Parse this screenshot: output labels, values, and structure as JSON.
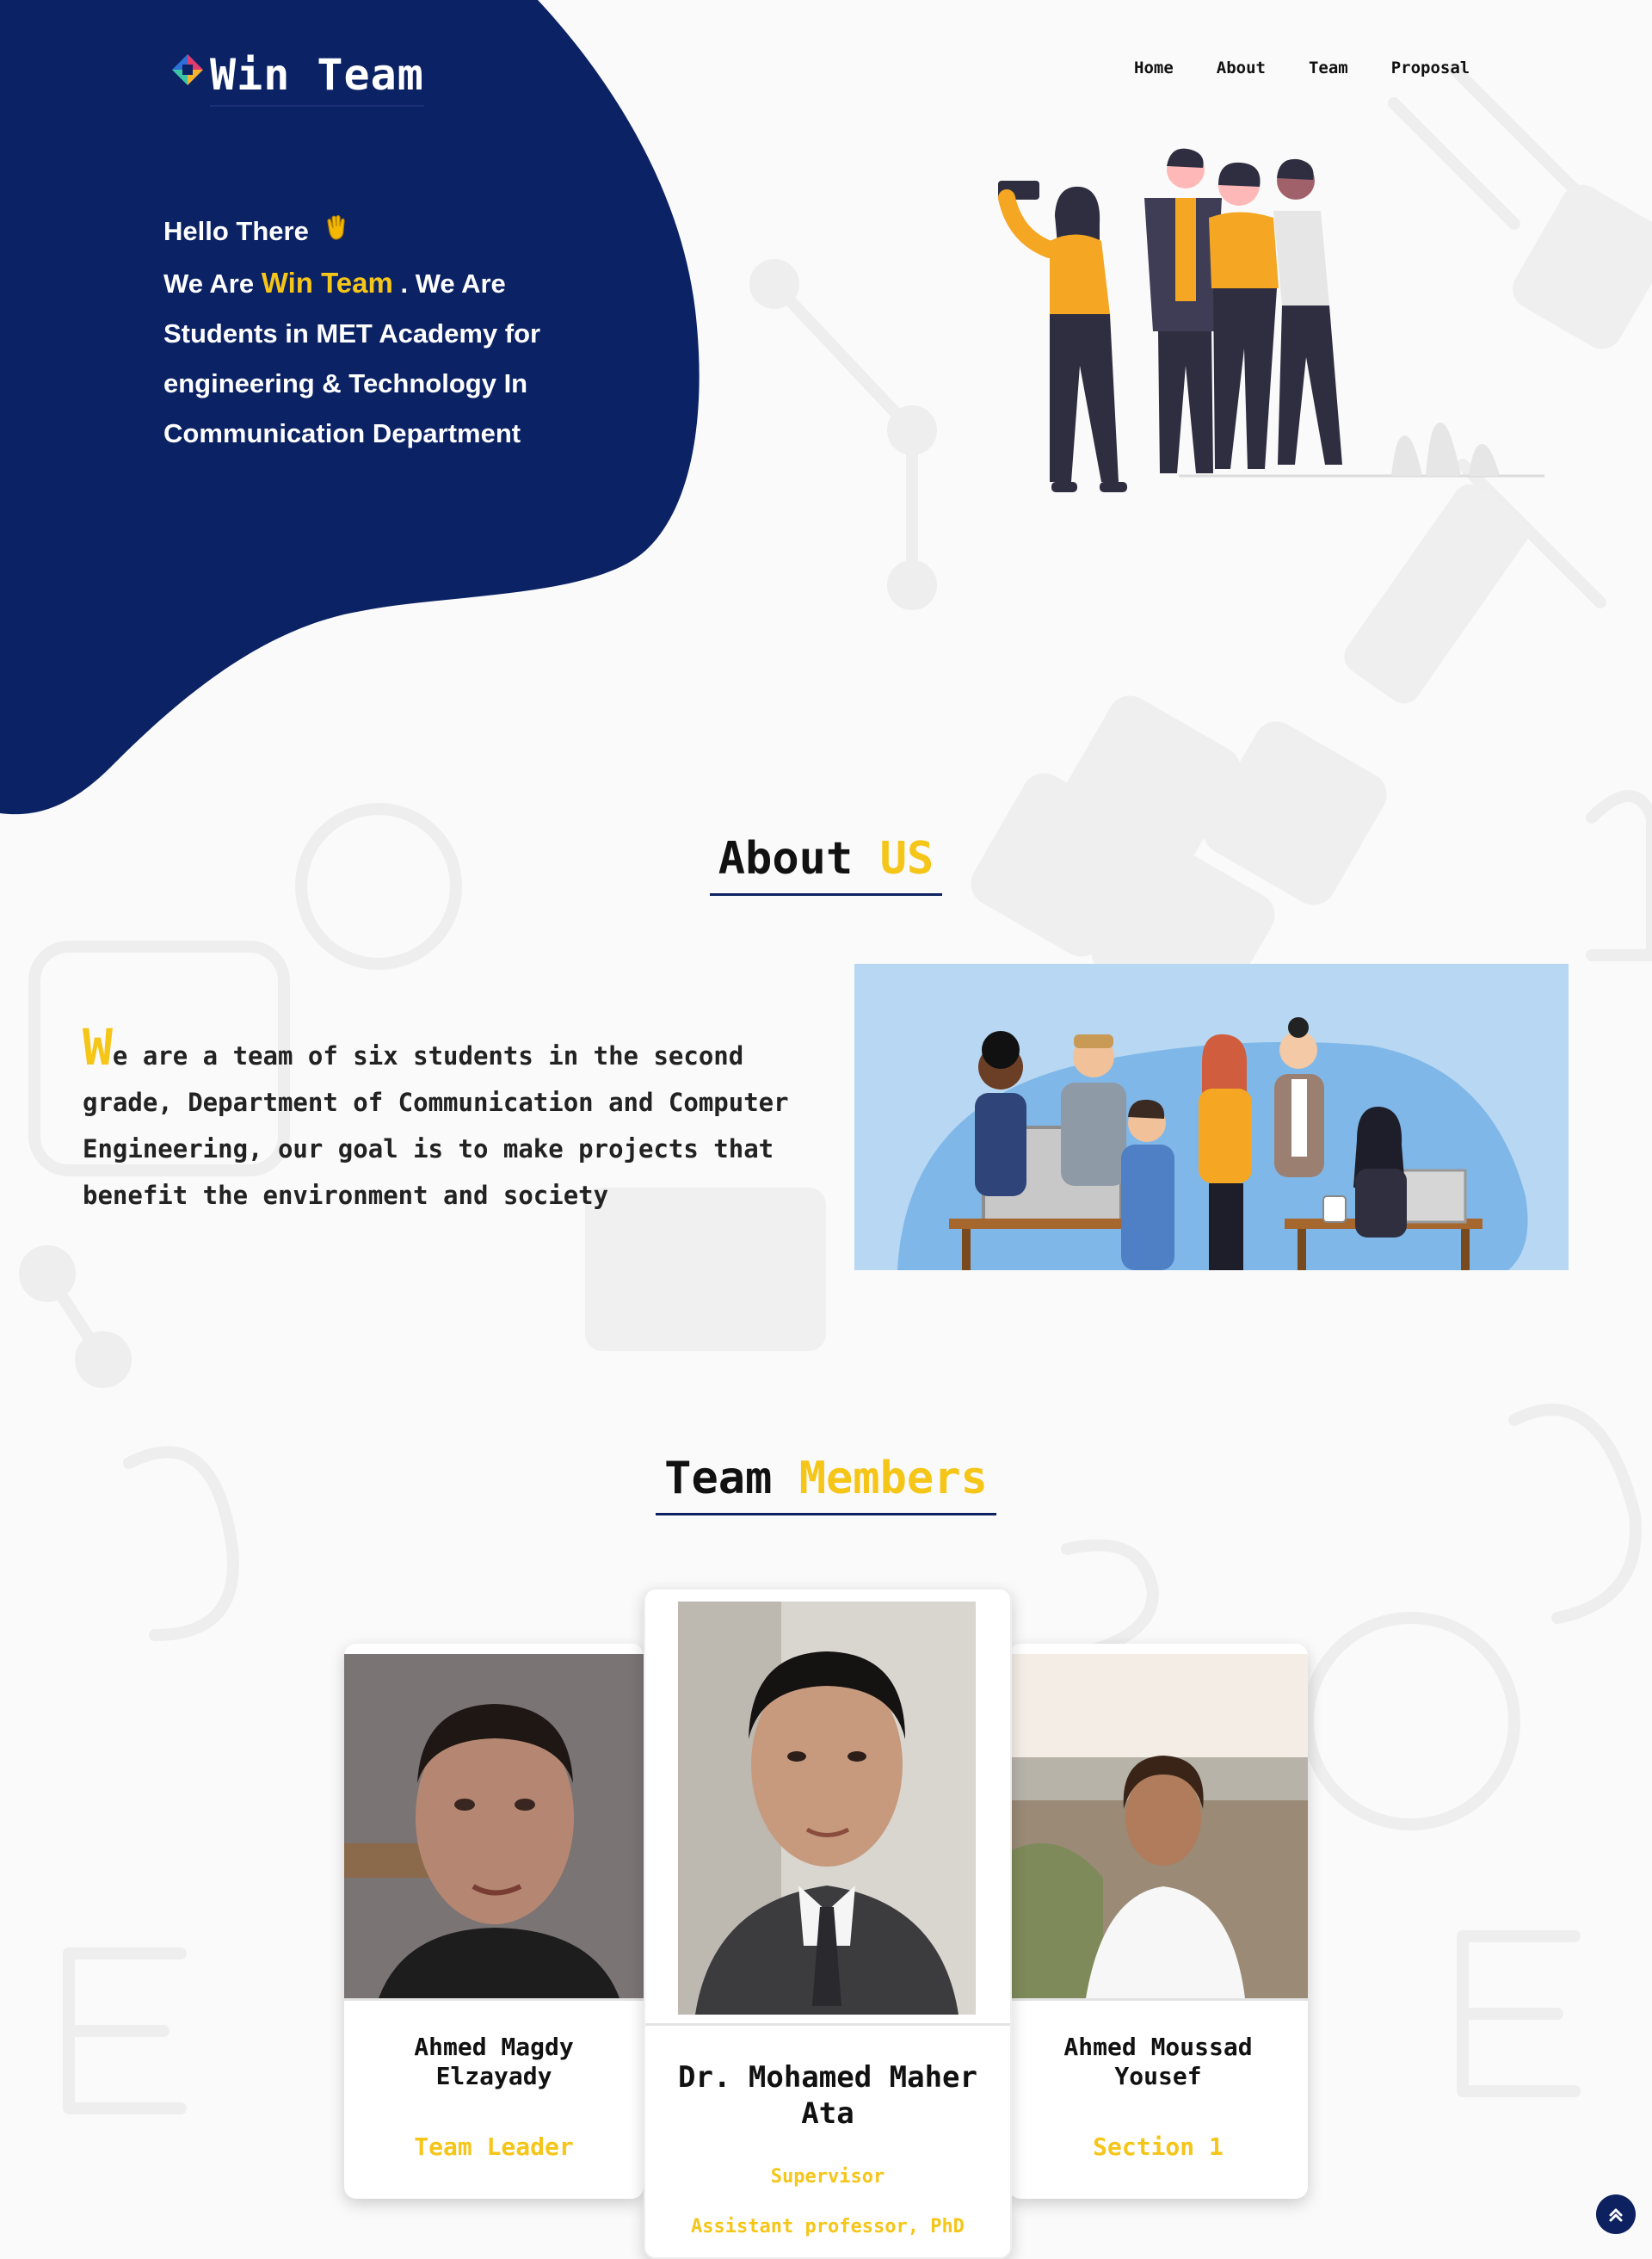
{
  "brand": {
    "title": "Win Team",
    "logo_icon": "colorful-diamond-logo-icon"
  },
  "nav": {
    "items": [
      "Home",
      "About",
      "Team",
      "Proposal"
    ]
  },
  "hero": {
    "greeting": "Hello There",
    "greeting_icon": "waving-hand-icon",
    "line_prefix": "We Are",
    "team_name": "Win Team",
    "line_suffix": ". We Are Students in MET Academy for engineering & Technology In Communication Department"
  },
  "about": {
    "title_main": "About",
    "title_accent": "US",
    "dropcap": "W",
    "text": "e are a team of six students in the second grade, Department of Communication and Computer Engineering, our goal is to make projects that benefit the environment and society"
  },
  "team": {
    "title_main": "Team",
    "title_accent": "Members",
    "members": [
      {
        "name": "Ahmed Magdy Elzayady",
        "role": "Team Leader"
      },
      {
        "name": "Dr. Mohamed Maher Ata",
        "role": "Supervisor",
        "subrole": "Assistant professor, PhD"
      },
      {
        "name": "Ahmed Moussad Yousef",
        "role": "Section 1"
      }
    ]
  },
  "colors": {
    "navy": "#0b2265",
    "accent": "#f5c518",
    "background": "#fafafa"
  },
  "scroll_top_icon": "double-chevron-up-icon"
}
